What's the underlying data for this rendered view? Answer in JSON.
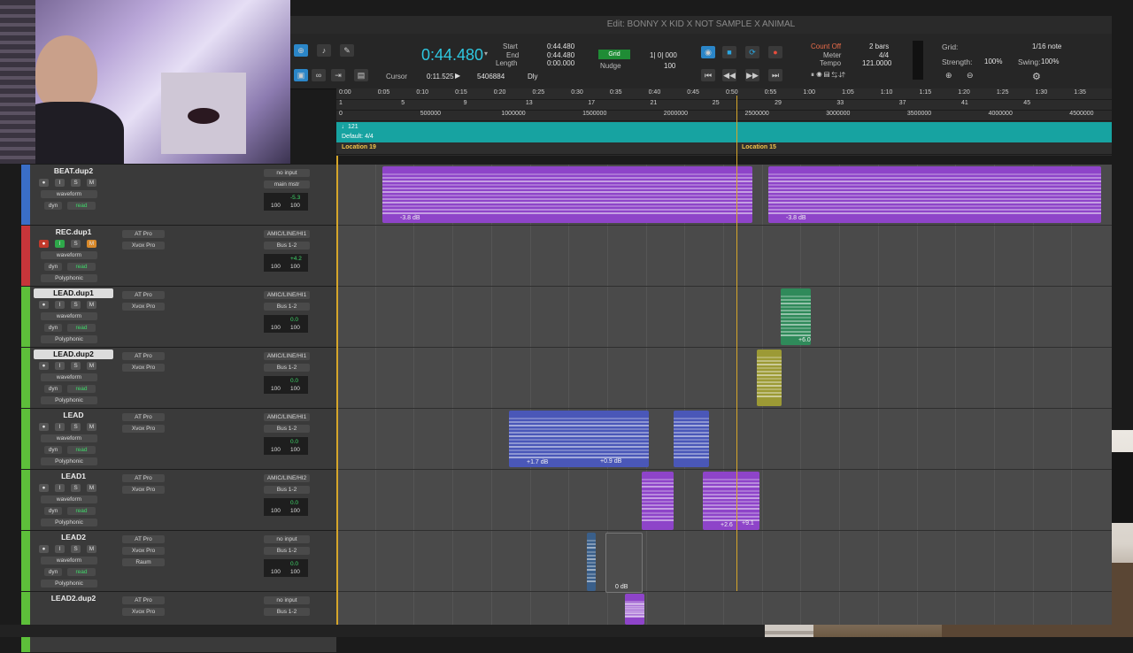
{
  "title": "Edit: BONNY X KID X NOT SAMPLE X ANIMAL",
  "transport": {
    "main_counter": "0:44.480",
    "start_label": "Start",
    "end_label": "End",
    "length_label": "Length",
    "start_value": "0:44.480",
    "end_value": "0:44.480",
    "length_value": "0:00.000",
    "cursor_label": "Cursor",
    "cursor_value": "0:11.525",
    "samples_value": "5406884",
    "dly_label": "Dly",
    "grid_label": "Grid",
    "grid_value": "1| 0| 000",
    "nudge_label": "Nudge",
    "nudge_value": "100",
    "count_off_label": "Count Off",
    "count_off_value": "2 bars",
    "meter_label": "Meter",
    "meter_value": "4/4",
    "tempo_label": "Tempo",
    "tempo_value": "121.0000",
    "grid2_label": "Grid:",
    "grid2_value": "1/16 note",
    "strength_label": "Strength:",
    "strength_value": "100%",
    "swing_label": "Swing:",
    "swing_value": "100%"
  },
  "ruler": {
    "minsecs": [
      "0:00",
      "0:05",
      "0:10",
      "0:15",
      "0:20",
      "0:25",
      "0:30",
      "0:35",
      "0:40",
      "0:45",
      "0:50",
      "0:55",
      "1:00",
      "1:05",
      "1:10",
      "1:15",
      "1:20",
      "1:25",
      "1:30",
      "1:35"
    ],
    "bars": [
      "1",
      "5",
      "9",
      "13",
      "17",
      "21",
      "25",
      "29",
      "33",
      "37",
      "41",
      "45"
    ],
    "samples": [
      "0",
      "500000",
      "1000000",
      "1500000",
      "2000000",
      "2500000",
      "3000000",
      "3500000",
      "4000000",
      "4500000"
    ],
    "tempo_text": "♩121",
    "meter_text": "Default: 4/4",
    "marker_1": "Location 19",
    "marker_2": "Location 15"
  },
  "tracks": [
    {
      "name": "BEAT.dup2",
      "color": "#3a6ec7",
      "in1": "no input",
      "in2": "main mstr",
      "vol": "-5.3",
      "pan": "100",
      "pan2": "100",
      "insert1": "",
      "insert2": "",
      "view": "waveform",
      "dyn": "dyn",
      "mode": "read",
      "extra": ""
    },
    {
      "name": "REC.dup1",
      "color": "#c7353a",
      "in1": "AMIC/LINE/HI1",
      "in2": "Bus 1-2",
      "vol": "+4.2",
      "pan": "100",
      "pan2": "100",
      "insert1": "AT Pro",
      "insert2": "Xvox Pro",
      "view": "waveform",
      "dyn": "dyn",
      "mode": "read",
      "extra": "Polyphonic"
    },
    {
      "name": "LEAD.dup1",
      "color": "#5dbf3a",
      "in1": "AMIC/LINE/HI1",
      "in2": "Bus 1-2",
      "vol": "0.0",
      "pan": "100",
      "pan2": "100",
      "insert1": "AT Pro",
      "insert2": "Xvox Pro",
      "view": "waveform",
      "dyn": "dyn",
      "mode": "read",
      "extra": "Polyphonic"
    },
    {
      "name": "LEAD.dup2",
      "color": "#5dbf3a",
      "in1": "AMIC/LINE/HI1",
      "in2": "Bus 1-2",
      "vol": "0.0",
      "pan": "100",
      "pan2": "100",
      "insert1": "AT Pro",
      "insert2": "Xvox Pro",
      "view": "waveform",
      "dyn": "dyn",
      "mode": "read",
      "extra": "Polyphonic"
    },
    {
      "name": "LEAD",
      "color": "#5dbf3a",
      "in1": "AMIC/LINE/HI1",
      "in2": "Bus 1-2",
      "vol": "0.0",
      "pan": "100",
      "pan2": "100",
      "insert1": "AT Pro",
      "insert2": "Xvox Pro",
      "view": "waveform",
      "dyn": "dyn",
      "mode": "read",
      "extra": "Polyphonic"
    },
    {
      "name": "LEAD1",
      "color": "#5dbf3a",
      "in1": "AMIC/LINE/HI2",
      "in2": "Bus 1-2",
      "vol": "0.0",
      "pan": "100",
      "pan2": "100",
      "insert1": "AT Pro",
      "insert2": "Xvox Pro",
      "view": "waveform",
      "dyn": "dyn",
      "mode": "read",
      "extra": "Polyphonic"
    },
    {
      "name": "LEAD2",
      "color": "#5dbf3a",
      "in1": "no input",
      "in2": "Bus 1-2",
      "vol": "0.0",
      "pan": "100",
      "pan2": "100",
      "insert1": "AT Pro",
      "insert2": "Xvox Pro",
      "view": "waveform",
      "dyn": "dyn",
      "mode": "read",
      "extra": "Polyphonic",
      "insert3": "Raum"
    },
    {
      "name": "LEAD2.dup2",
      "color": "#5dbf3a",
      "in1": "no input",
      "in2": "Bus 1-2",
      "vol": "",
      "pan": "",
      "pan2": "",
      "insert1": "AT Pro",
      "insert2": "Xvox Pro",
      "view": "",
      "dyn": "",
      "mode": "",
      "extra": ""
    }
  ],
  "clips": {
    "beat_a": "-3.8 dB",
    "beat_b": "-3.8 dB",
    "lead_dup1": "+6.0",
    "lead_a": "+1.7 dB",
    "lead_b": "+0.9 dB",
    "lead1_a": "+2.6",
    "lead1_b": "+9.1",
    "lead2_a": "0 dB"
  },
  "colors": {
    "purple": "#8e44c9",
    "green": "#2f8a5a",
    "yellow": "#9c9a35",
    "blue": "#4a57b8",
    "teal": "#17a3a1",
    "playhead": "#d6a62a"
  }
}
